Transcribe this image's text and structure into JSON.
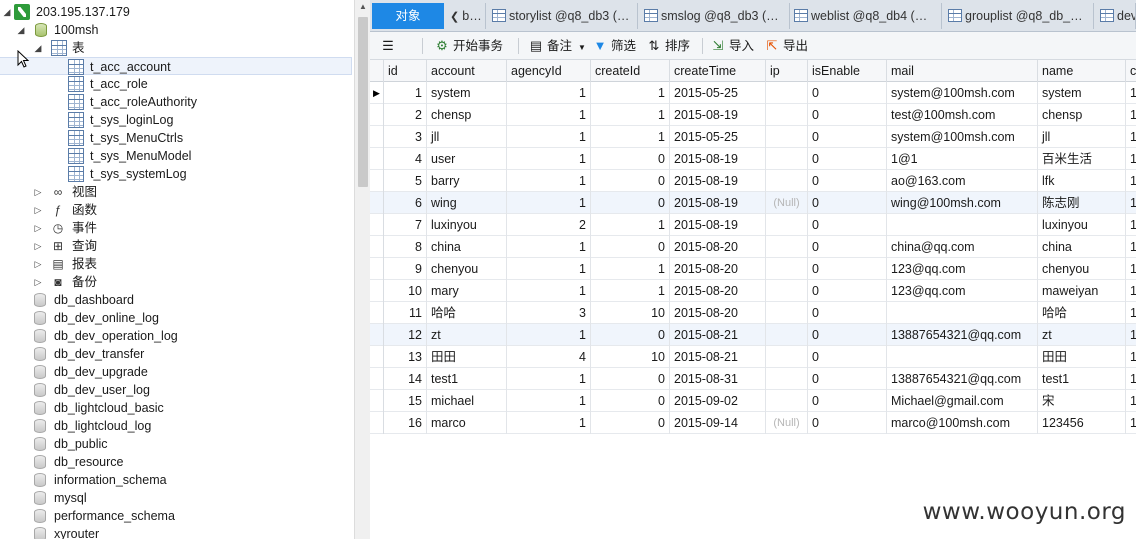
{
  "tree": {
    "connection": "203.195.137.179",
    "database": "100msh",
    "tables_folder": "表",
    "tables": [
      "t_acc_account",
      "t_acc_role",
      "t_acc_roleAuthority",
      "t_sys_loginLog",
      "t_sys_MenuCtrls",
      "t_sys_MenuModel",
      "t_sys_systemLog"
    ],
    "selected_table": "t_acc_account",
    "folders": [
      {
        "label": "视图",
        "icon": "view-icon"
      },
      {
        "label": "函数",
        "icon": "function-icon"
      },
      {
        "label": "事件",
        "icon": "event-icon"
      },
      {
        "label": "查询",
        "icon": "query-icon"
      },
      {
        "label": "报表",
        "icon": "report-icon"
      },
      {
        "label": "备份",
        "icon": "backup-icon"
      }
    ],
    "databases": [
      "db_dashboard",
      "db_dev_online_log",
      "db_dev_operation_log",
      "db_dev_transfer",
      "db_dev_upgrade",
      "db_dev_user_log",
      "db_lightcloud_basic",
      "db_lightcloud_log",
      "db_public",
      "db_resource",
      "information_schema",
      "mysql",
      "performance_schema",
      "xyrouter"
    ]
  },
  "tabs": [
    {
      "label": "对象",
      "active": true
    },
    {
      "label": "b…",
      "active": false
    },
    {
      "label": "storylist @q8_db3 (…",
      "active": false
    },
    {
      "label": "smslog @q8_db3 (…",
      "active": false
    },
    {
      "label": "weblist @q8_db4 (…",
      "active": false
    },
    {
      "label": "grouplist @q8_db_…",
      "active": false
    },
    {
      "label": "devl",
      "active": false
    }
  ],
  "toolbar": {
    "begin_transaction": "开始事务",
    "memo": "备注",
    "filter": "筛选",
    "sort": "排序",
    "import": "导入",
    "export": "导出"
  },
  "grid": {
    "columns": [
      "id",
      "account",
      "agencyId",
      "createId",
      "createTime",
      "ip",
      "isEnable",
      "mail",
      "name",
      "c"
    ],
    "rows": [
      [
        "1",
        "system",
        "1",
        "1",
        "2015-05-25",
        "",
        "0",
        "system@100msh.com",
        "system",
        "1"
      ],
      [
        "2",
        "chensp",
        "1",
        "1",
        "2015-08-19",
        "",
        "0",
        "test@100msh.com",
        "chensp",
        "1"
      ],
      [
        "3",
        "jll",
        "1",
        "1",
        "2015-05-25",
        "",
        "0",
        "system@100msh.com",
        "jll",
        "1"
      ],
      [
        "4",
        "user",
        "1",
        "0",
        "2015-08-19",
        "",
        "0",
        "1@1",
        "百米生活",
        "1"
      ],
      [
        "5",
        "barry",
        "1",
        "0",
        "2015-08-19",
        "",
        "0",
        "ao@163.com",
        "lfk",
        "1"
      ],
      [
        "6",
        "wing",
        "1",
        "0",
        "2015-08-19",
        "(Null)",
        "0",
        "wing@100msh.com",
        "陈志刚",
        "1"
      ],
      [
        "7",
        "luxinyou",
        "2",
        "1",
        "2015-08-19",
        "",
        "0",
        "",
        "luxinyou",
        "1"
      ],
      [
        "8",
        "china",
        "1",
        "0",
        "2015-08-20",
        "",
        "0",
        "china@qq.com",
        "china",
        "1"
      ],
      [
        "9",
        "chenyou",
        "1",
        "1",
        "2015-08-20",
        "",
        "0",
        "123@qq.com",
        "chenyou",
        "1"
      ],
      [
        "10",
        "mary",
        "1",
        "1",
        "2015-08-20",
        "",
        "0",
        "123@qq.com",
        "maweiyan",
        "1"
      ],
      [
        "11",
        "哈哈",
        "3",
        "10",
        "2015-08-20",
        "",
        "0",
        "",
        "哈哈",
        "1"
      ],
      [
        "12",
        "zt",
        "1",
        "0",
        "2015-08-21",
        "",
        "0",
        "13887654321@qq.com",
        "zt",
        "1"
      ],
      [
        "13",
        "田田",
        "4",
        "10",
        "2015-08-21",
        "",
        "0",
        "",
        "田田",
        "1"
      ],
      [
        "14",
        "test1",
        "1",
        "0",
        "2015-08-31",
        "",
        "0",
        "13887654321@qq.com",
        "test1",
        "1"
      ],
      [
        "15",
        "michael",
        "1",
        "0",
        "2015-09-02",
        "",
        "0",
        "Michael@gmail.com",
        "宋",
        "1"
      ],
      [
        "16",
        "marco",
        "1",
        "0",
        "2015-09-14",
        "(Null)",
        "0",
        "marco@100msh.com",
        "123456",
        "1"
      ]
    ]
  },
  "watermark": "www.wooyun.org"
}
